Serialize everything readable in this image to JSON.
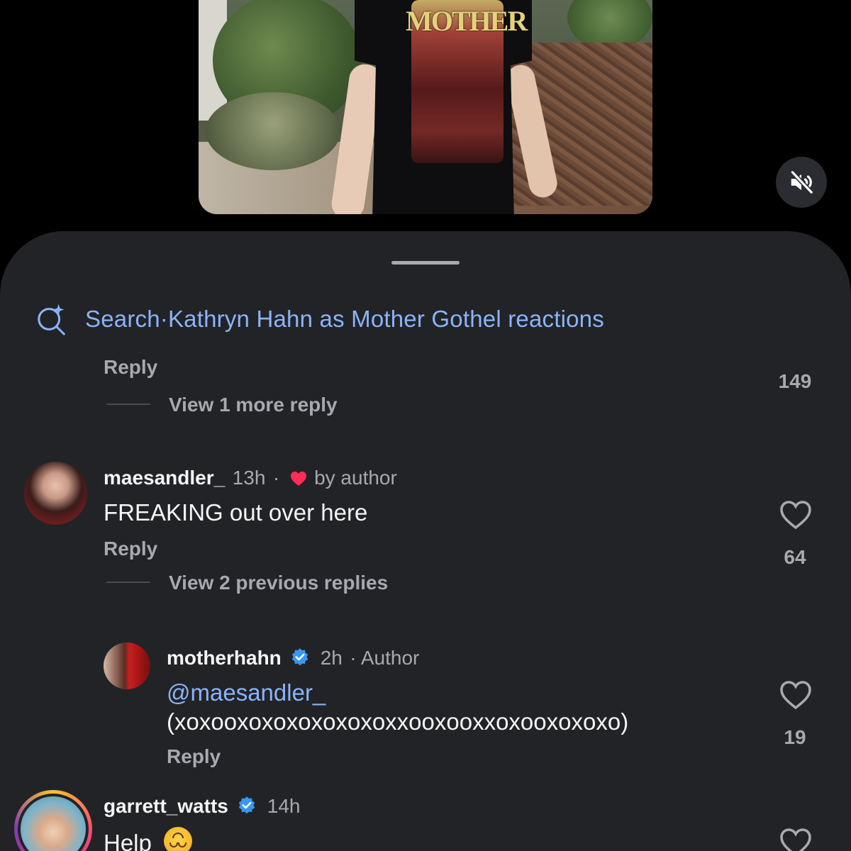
{
  "video": {
    "shirt_text": "MOTHER"
  },
  "search": {
    "label": "Search",
    "separator": " · ",
    "query": "Kathryn Hahn as Mother Gothel reactions"
  },
  "thread_top": {
    "reply_label": "Reply",
    "view_more": "View 1 more reply",
    "like_count": "149"
  },
  "comments": [
    {
      "username": "maesandler_",
      "time": "13h",
      "separator": "·",
      "liked_by": "by author",
      "text": "FREAKING out over here",
      "reply_label": "Reply",
      "like_count": "64",
      "view_replies": "View 2 previous replies",
      "heart_color": "#ff2d55"
    },
    {
      "username": "motherhahn",
      "verified": true,
      "time": "2h",
      "role": "· Author",
      "mention": "@maesandler_",
      "text": "(xoxooxoxoxoxoxoxoxxooxooxxoxooxoxoxo)",
      "reply_label": "Reply",
      "like_count": "19"
    },
    {
      "username": "garrett_watts",
      "verified": true,
      "time": "14h",
      "text": "Help",
      "emoji": "upside-down-face"
    }
  ],
  "colors": {
    "accent": "#8ab4f8",
    "verified": "#3897f0",
    "sheet": "#222327"
  }
}
